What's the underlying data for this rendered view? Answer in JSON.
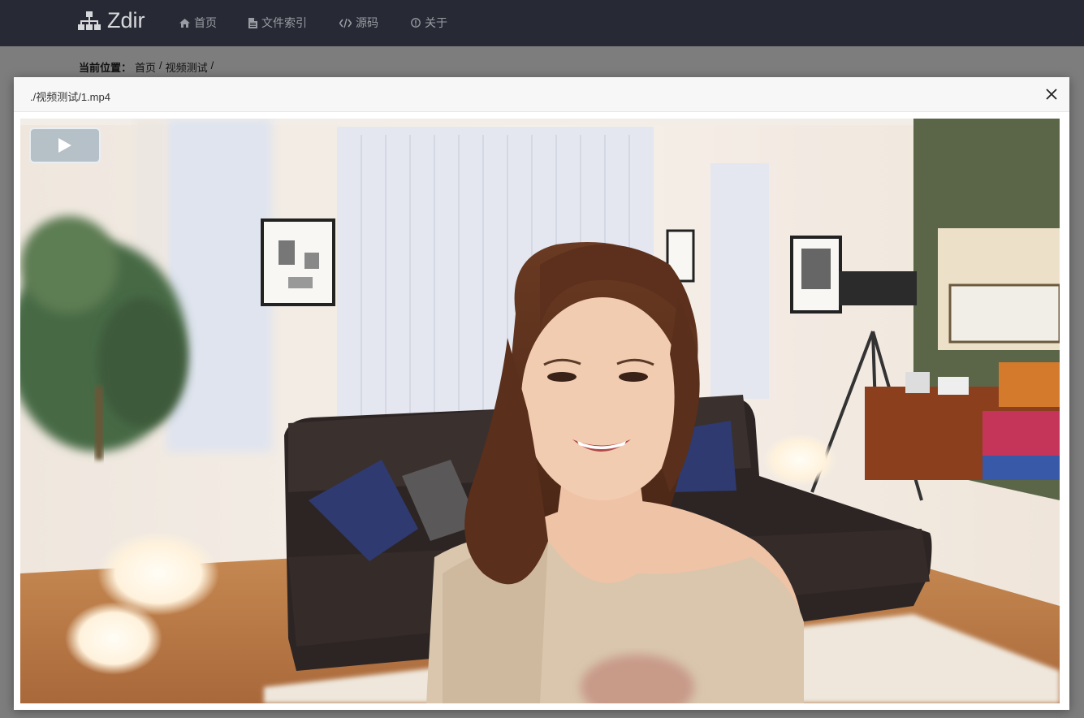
{
  "navbar": {
    "brand": "Zdir",
    "items": [
      {
        "label": "首页",
        "icon": "home-icon"
      },
      {
        "label": "文件索引",
        "icon": "file-icon"
      },
      {
        "label": "源码",
        "icon": "code-icon"
      },
      {
        "label": "关于",
        "icon": "info-icon"
      }
    ]
  },
  "breadcrumb": {
    "label": "当前位置：",
    "items": [
      "首页",
      "/",
      "视频测试",
      "/"
    ]
  },
  "modal": {
    "title": "./视频测试/1.mp4",
    "close_icon": "close-icon"
  },
  "video": {
    "play_icon": "play-icon",
    "state": "paused"
  },
  "colors": {
    "navbar_bg": "#272a34",
    "nav_text": "#9a9ca3",
    "brand_text": "#d7d8db",
    "overlay": "#7d7d7d"
  }
}
